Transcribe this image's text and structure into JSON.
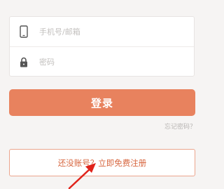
{
  "login_form": {
    "phone_placeholder": "手机号/邮箱",
    "phone_icon": "phone-icon",
    "password_placeholder": "密码",
    "password_icon": "lock-icon"
  },
  "login_button_label": "登录",
  "forgot_password_label": "忘记密码？",
  "register_button_label": "还没账号？立即免费注册",
  "colors": {
    "accent": "#e8825e",
    "register_text": "#d7663f",
    "annotation_arrow": "#e0231b"
  }
}
